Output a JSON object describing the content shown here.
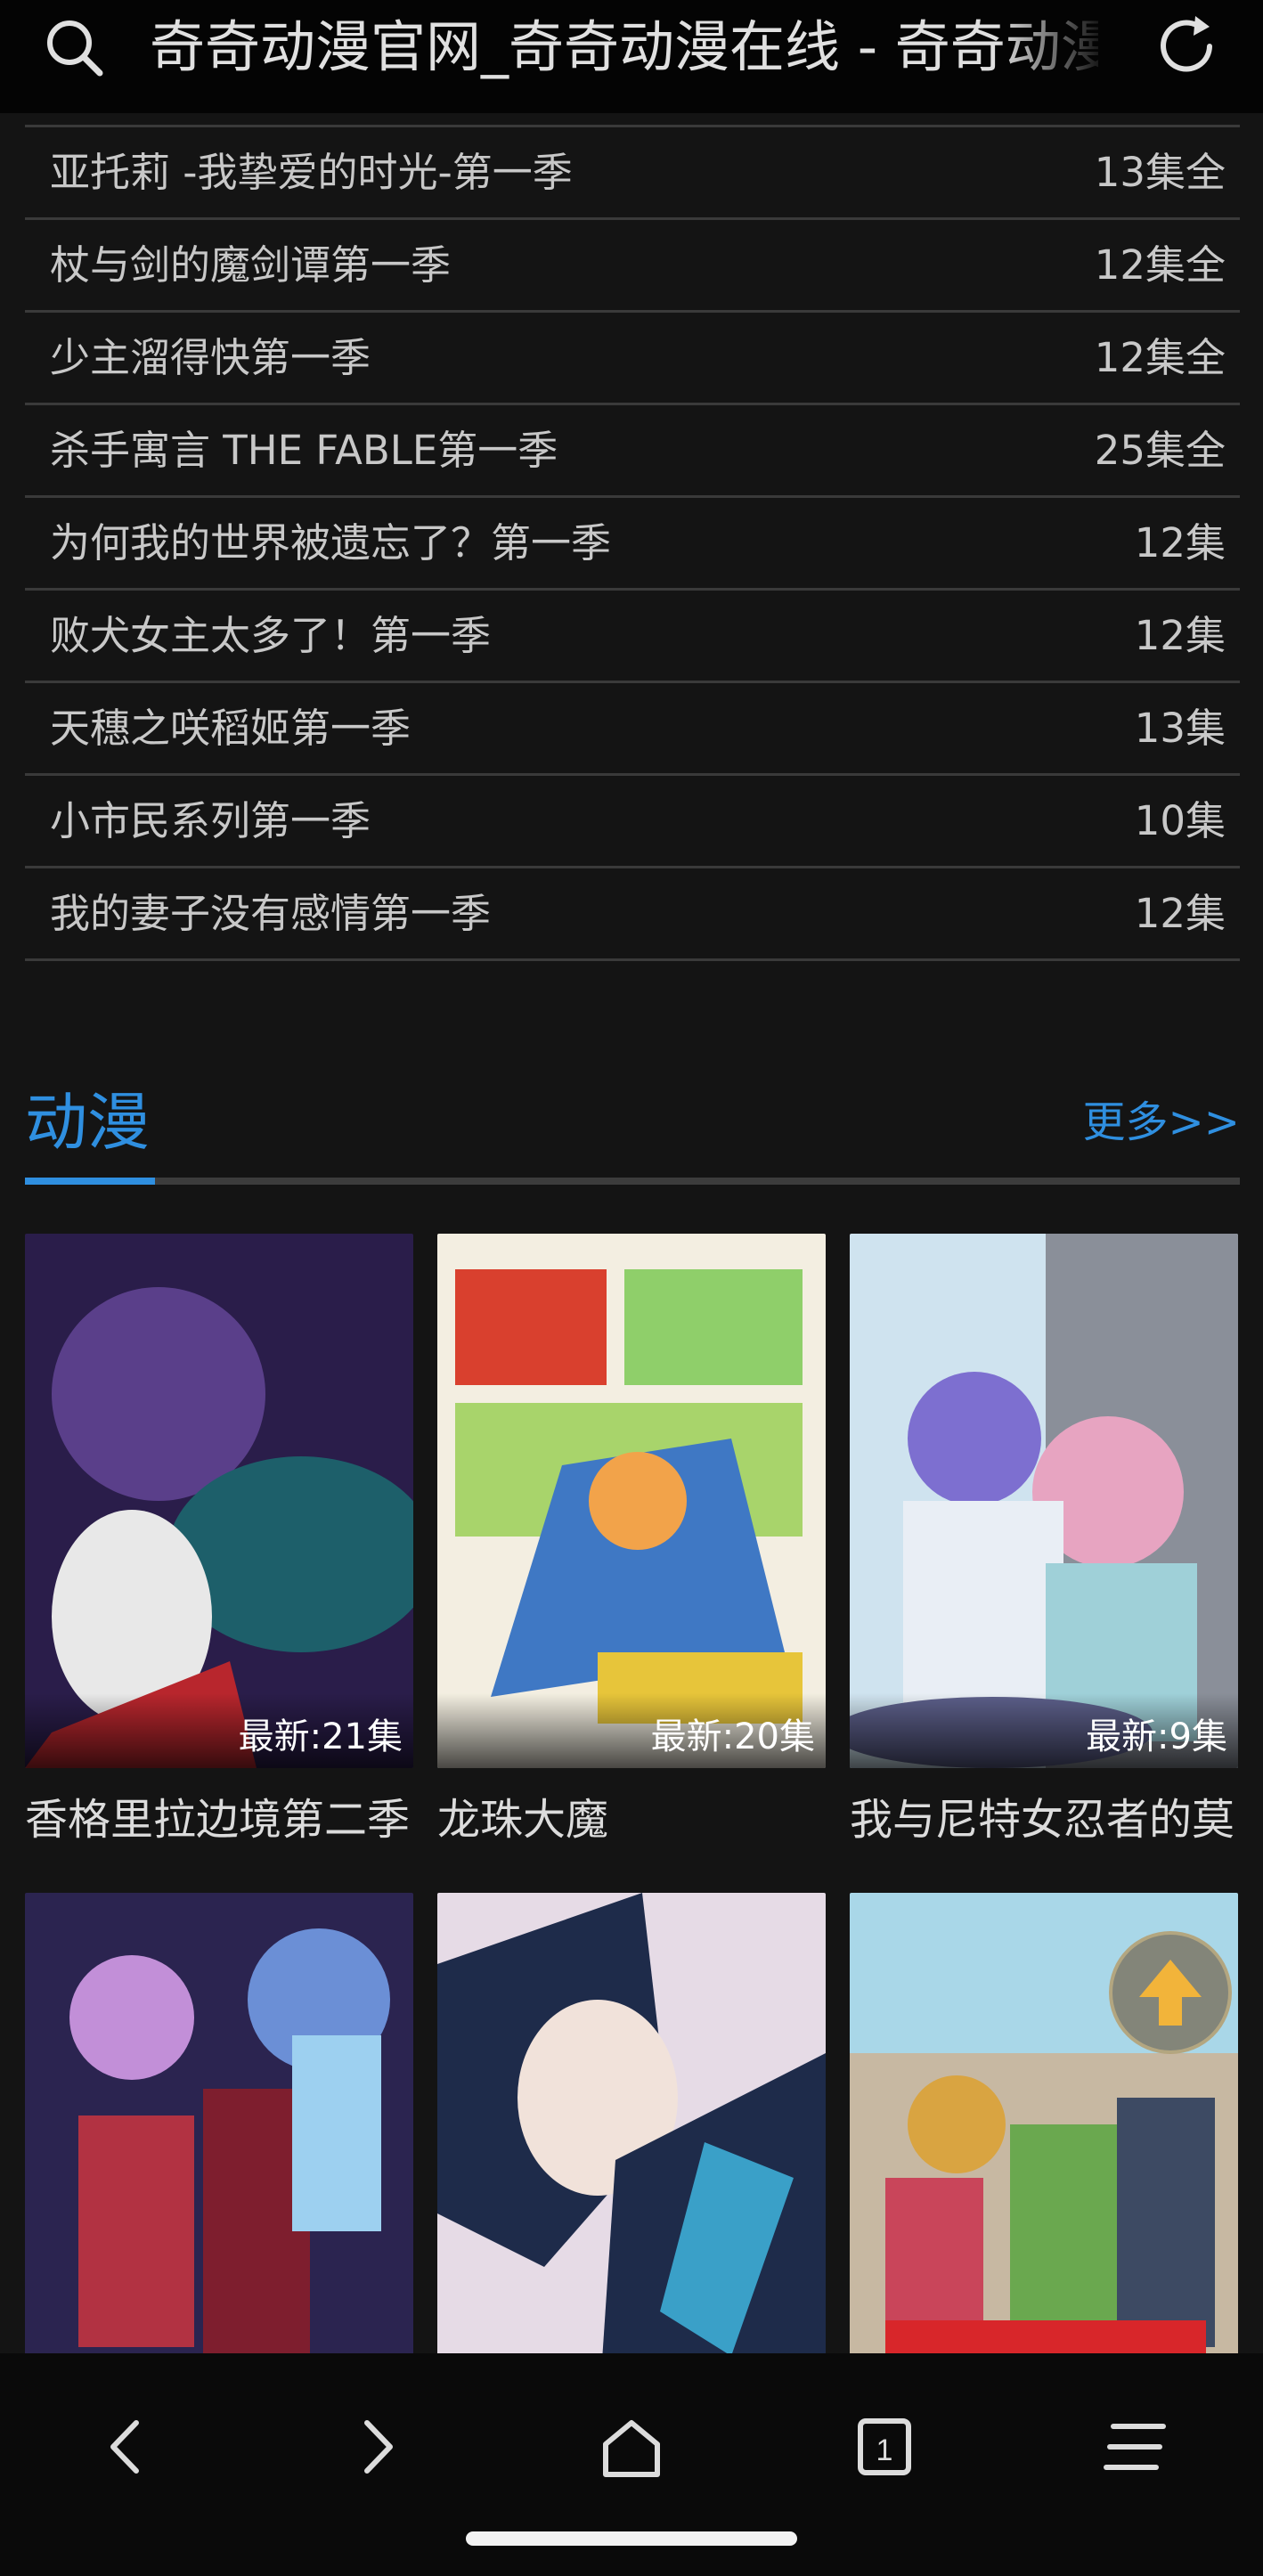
{
  "browser": {
    "page_title": "奇奇动漫官网_奇奇动漫在线 - 奇奇动漫"
  },
  "list": [
    {
      "name": "亚托莉 -我挚爱的时光-第一季",
      "count": "13集全"
    },
    {
      "name": "杖与剑的魔剑谭第一季",
      "count": "12集全"
    },
    {
      "name": "少主溜得快第一季",
      "count": "12集全"
    },
    {
      "name": "杀手寓言 THE FABLE第一季",
      "count": "25集全"
    },
    {
      "name": "为何我的世界被遗忘了？第一季",
      "count": "12集"
    },
    {
      "name": "败犬女主太多了！第一季",
      "count": "12集"
    },
    {
      "name": "天穗之咲稻姬第一季",
      "count": "13集"
    },
    {
      "name": "小市民系列第一季",
      "count": "10集"
    },
    {
      "name": "我的妻子没有感情第一季",
      "count": "12集"
    }
  ],
  "section": {
    "label": "动漫",
    "more": "更多>>"
  },
  "cards": [
    {
      "title": "香格里拉边境第二季",
      "badge": "最新:21集",
      "colors": [
        "#2a1d4a",
        "#5a3f8a",
        "#1d5f6a"
      ]
    },
    {
      "title": "龙珠大魔",
      "badge": "最新:20集",
      "colors": [
        "#f3eee1",
        "#d9402e",
        "#3f78c4"
      ]
    },
    {
      "title": "我与尼特女忍者的莫",
      "badge": "最新:9集",
      "colors": [
        "#cfe3ef",
        "#e7a4c1",
        "#5c5f8a"
      ]
    },
    {
      "title": "",
      "badge": "",
      "colors": [
        "#2b2450",
        "#b23242",
        "#6b8fd6"
      ]
    },
    {
      "title": "",
      "badge": "",
      "colors": [
        "#e6dbe6",
        "#1e2b4a",
        "#3aa0c8"
      ]
    },
    {
      "title": "",
      "badge": "",
      "colors": [
        "#a9d7e8",
        "#6aa84f",
        "#d9a441"
      ]
    }
  ],
  "colors": {
    "accent": "#2f8fe0",
    "background": "#141414"
  }
}
